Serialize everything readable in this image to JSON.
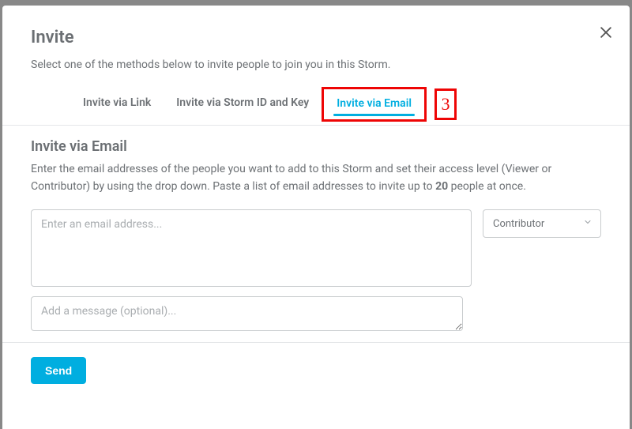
{
  "modal": {
    "title": "Invite",
    "subtitle": "Select one of the methods below to invite people to join you in this Storm."
  },
  "tabs": {
    "link": "Invite via Link",
    "storm_id": "Invite via Storm ID and Key",
    "email": "Invite via Email"
  },
  "annotation": {
    "step_number": "3"
  },
  "panel": {
    "title": "Invite via Email",
    "desc_pre": "Enter the email addresses of the people you want to add to this Storm and set their access level (Viewer or Contributor) by using the drop down. Paste a list of email addresses to invite up to ",
    "desc_bold": "20",
    "desc_post": " people at once."
  },
  "form": {
    "email_placeholder": "Enter an email address...",
    "role_selected": "Contributor",
    "message_placeholder": "Add a message (optional)..."
  },
  "footer": {
    "send_label": "Send"
  }
}
